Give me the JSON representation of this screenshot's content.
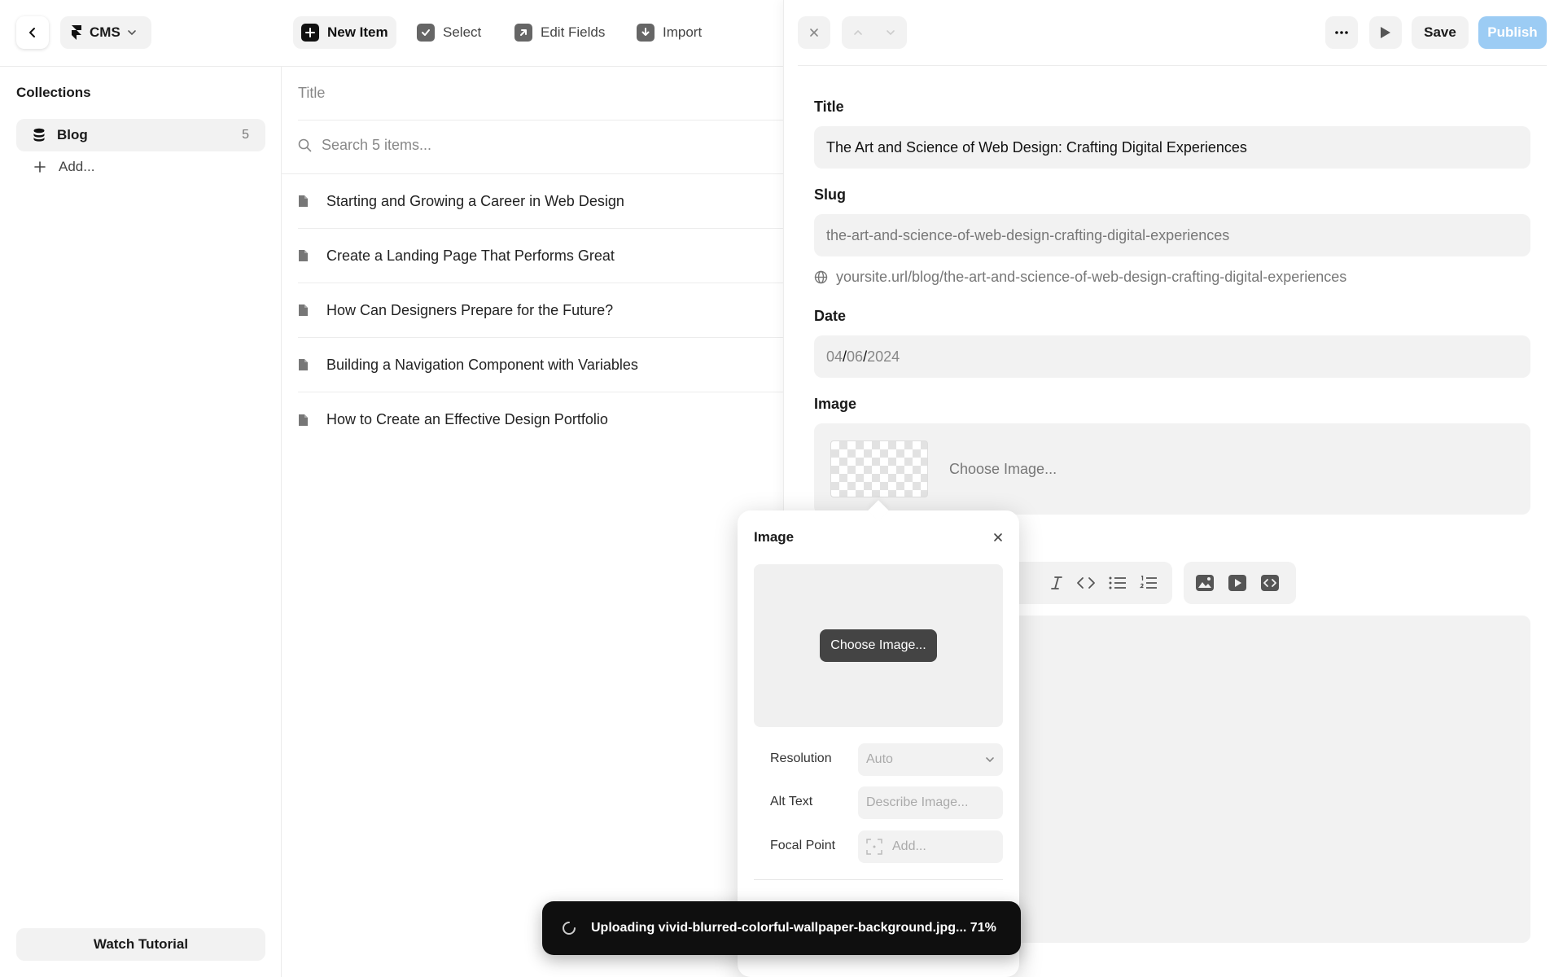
{
  "header": {
    "app_switcher_label": "CMS",
    "tools": {
      "new_item": "New Item",
      "select": "Select",
      "edit_fields": "Edit Fields",
      "import": "Import"
    }
  },
  "sidebar": {
    "title": "Collections",
    "collections": [
      {
        "label": "Blog",
        "count": "5",
        "icon": "database-icon"
      }
    ],
    "add_label": "Add...",
    "watch_tutorial": "Watch Tutorial"
  },
  "list": {
    "column_title": "Title",
    "search_placeholder": "Search 5 items...",
    "items": [
      "Starting and Growing a Career in Web Design",
      "Create a Landing Page That Performs Great",
      "How Can Designers Prepare for the Future?",
      "Building a Navigation Component with Variables",
      "How to Create an Effective Design Portfolio"
    ]
  },
  "editor": {
    "actions": {
      "save": "Save",
      "publish": "Publish"
    },
    "fields": {
      "title_label": "Title",
      "title_value": "The Art and Science of Web Design: Crafting Digital Experiences",
      "slug_label": "Slug",
      "slug_value": "the-art-and-science-of-web-design-crafting-digital-experiences",
      "slug_url": "yoursite.url/blog/the-art-and-science-of-web-design-crafting-digital-experiences",
      "date_label": "Date",
      "date_month": "04",
      "date_day": "06",
      "date_year": "2024",
      "date_sep": "/",
      "image_label": "Image",
      "image_choose": "Choose Image..."
    }
  },
  "image_popover": {
    "title": "Image",
    "choose_button": "Choose Image...",
    "resolution_label": "Resolution",
    "resolution_value": "Auto",
    "alt_text_label": "Alt Text",
    "alt_text_placeholder": "Describe Image...",
    "focal_point_label": "Focal Point",
    "focal_point_placeholder": "Add..."
  },
  "toast": {
    "message": "Uploading vivid-blurred-colorful-wallpaper-background.jpg... 71%"
  },
  "colors": {
    "publish_bg": "#9cccf4",
    "toast_bg": "#0f0f0f",
    "field_bg": "#f2f2f2"
  }
}
